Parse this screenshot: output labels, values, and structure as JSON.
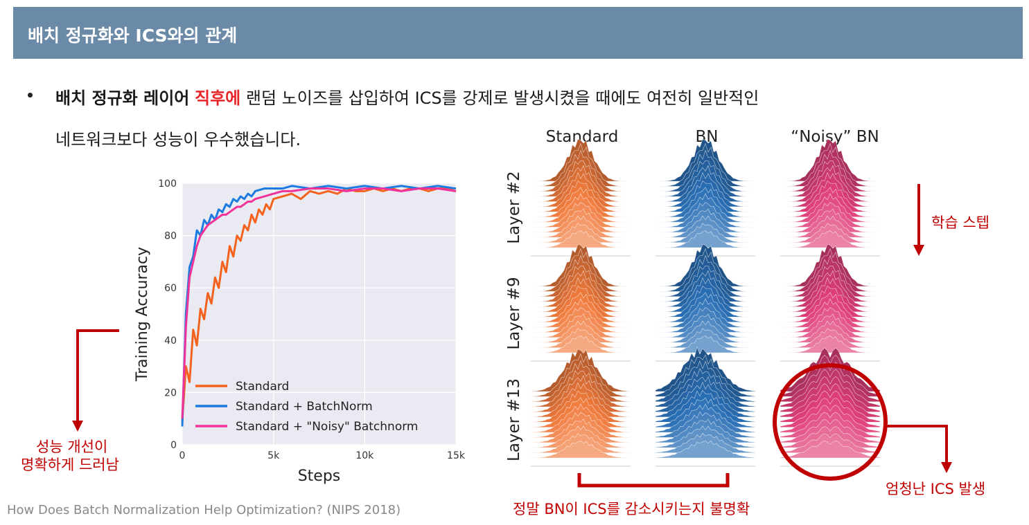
{
  "header": {
    "title": "배치 정규화와 ICS와의 관계"
  },
  "bullet": {
    "bold_part": "배치 정규화 레이어",
    "red_part": "직후에",
    "rest_line1": "랜덤 노이즈를 삽입하여 ICS를 강제로 발생시켰을 때에도 여전히 일반적인",
    "line2": "네트워크보다 성능이 우수했습니다."
  },
  "distribution_grid": {
    "columns": [
      "Standard",
      "BN",
      "“Noisy” BN"
    ],
    "rows": [
      "Layer #2",
      "Layer #9",
      "Layer #13"
    ],
    "colors": {
      "Standard": "#f07a3c",
      "BN": "#2a6fb5",
      "Noisy": "#e0407a"
    }
  },
  "annotations": {
    "step_label": "학습 스텝",
    "perf_label_1": "성능 개선이",
    "perf_label_2": "명확하게 드러남",
    "bn_unclear": "정말 BN이 ICS를 감소시키는지 불명확",
    "ics_big": "엄청난 ICS 발생",
    "accent_color": "#c00000"
  },
  "citation": "How Does Batch Normalization Help Optimization? (NIPS 2018)",
  "chart_data": {
    "type": "line",
    "xlabel": "Steps",
    "ylabel": "Training Accuracy",
    "xlim": [
      0,
      15000
    ],
    "ylim": [
      0,
      100
    ],
    "xticks": [
      0,
      5000,
      10000,
      15000
    ],
    "xtick_labels": [
      "0",
      "5k",
      "10k",
      "15k"
    ],
    "yticks": [
      0,
      20,
      40,
      60,
      80,
      100
    ],
    "ytick_labels": [
      "0",
      "20",
      "40",
      "60",
      "80",
      "100"
    ],
    "grid": true,
    "legend_position": "lower-right",
    "series": [
      {
        "name": "Standard",
        "color": "#f5621e",
        "x": [
          0,
          200,
          400,
          600,
          800,
          1000,
          1200,
          1400,
          1600,
          1800,
          2000,
          2200,
          2400,
          2600,
          2800,
          3000,
          3200,
          3400,
          3600,
          3800,
          4000,
          4200,
          4400,
          4600,
          4800,
          5000,
          5500,
          6000,
          6500,
          7000,
          7500,
          8000,
          8500,
          9000,
          9500,
          10000,
          10500,
          11000,
          11500,
          12000,
          12500,
          13000,
          13500,
          14000,
          14500,
          15000
        ],
        "y": [
          9,
          30,
          24,
          44,
          38,
          52,
          48,
          58,
          54,
          64,
          60,
          70,
          66,
          76,
          72,
          80,
          78,
          84,
          82,
          88,
          85,
          90,
          88,
          92,
          90,
          94,
          95,
          96,
          94,
          97,
          96,
          97,
          96,
          98,
          97,
          97,
          98,
          97,
          98,
          97,
          98,
          98,
          97,
          98,
          98,
          97
        ]
      },
      {
        "name": "Standard + BatchNorm",
        "color": "#1c7be0",
        "x": [
          0,
          200,
          400,
          600,
          800,
          1000,
          1200,
          1400,
          1600,
          1800,
          2000,
          2200,
          2400,
          2600,
          2800,
          3000,
          3200,
          3400,
          3600,
          3800,
          4000,
          4500,
          5000,
          5500,
          6000,
          7000,
          8000,
          9000,
          10000,
          11000,
          12000,
          13000,
          14000,
          15000
        ],
        "y": [
          7,
          50,
          68,
          72,
          82,
          80,
          86,
          84,
          88,
          86,
          90,
          89,
          92,
          91,
          94,
          93,
          95,
          94,
          96,
          95,
          97,
          98,
          98,
          98,
          99,
          98,
          99,
          98,
          99,
          98,
          99,
          98,
          99,
          98
        ]
      },
      {
        "name": "Standard + \"Noisy\" Batchnorm",
        "color": "#f0339a",
        "x": [
          0,
          200,
          400,
          600,
          800,
          1000,
          1200,
          1400,
          1600,
          1800,
          2000,
          2200,
          2400,
          2600,
          2800,
          3000,
          3200,
          3400,
          3600,
          3800,
          4000,
          4500,
          5000,
          5500,
          6000,
          7000,
          8000,
          9000,
          10000,
          11000,
          12000,
          13000,
          14000,
          15000
        ],
        "y": [
          10,
          45,
          64,
          70,
          76,
          80,
          82,
          84,
          85,
          86,
          87,
          88,
          88,
          89,
          90,
          91,
          91,
          92,
          93,
          93,
          94,
          95,
          96,
          97,
          97,
          98,
          98,
          97,
          98,
          98,
          97,
          98,
          98,
          97
        ]
      }
    ]
  }
}
